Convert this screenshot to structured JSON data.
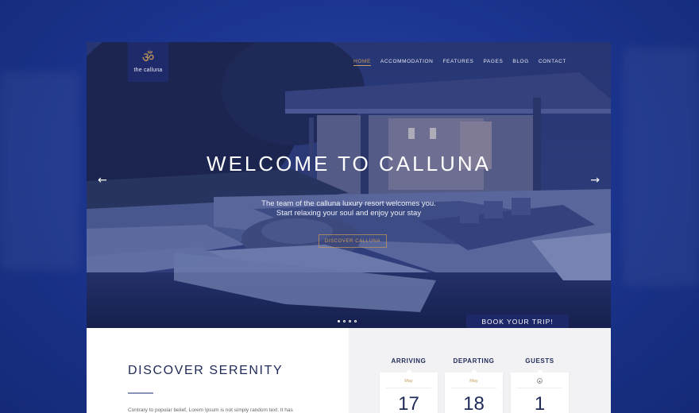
{
  "brand": {
    "logo_glyph": "ॐ",
    "name": "the calluna",
    "accent": "#c69a5a",
    "navy": "#1c2868"
  },
  "nav": {
    "items": [
      {
        "label": "HOME",
        "active": true
      },
      {
        "label": "ACCOMMODATION",
        "active": false
      },
      {
        "label": "FEATURES",
        "active": false
      },
      {
        "label": "PAGES",
        "active": false
      },
      {
        "label": "BLOG",
        "active": false
      },
      {
        "label": "CONTACT",
        "active": false
      }
    ]
  },
  "hero": {
    "title": "WELCOME TO CALLUNA",
    "subtitle_line1": "The team of the calluna luxury resort welcomes you.",
    "subtitle_line2": "Start relaxing your soul and enjoy your stay",
    "button_label": "DISCOVER CALLUNA",
    "prev_arrow": "←",
    "next_arrow": "→",
    "slides": [
      true,
      false,
      false,
      false
    ],
    "book_label": "BOOK YOUR TRIP!"
  },
  "intro": {
    "title": "DISCOVER SERENITY",
    "text": "Contrary to popular belief, Lorem Ipsum is not simply random text. It has"
  },
  "booking": {
    "arriving": {
      "label": "ARRIVING",
      "month": "May",
      "value": "17"
    },
    "departing": {
      "label": "DEPARTING",
      "month": "May",
      "value": "18"
    },
    "guests": {
      "label": "GUESTS",
      "up_icon": "▲",
      "value": "1"
    }
  }
}
